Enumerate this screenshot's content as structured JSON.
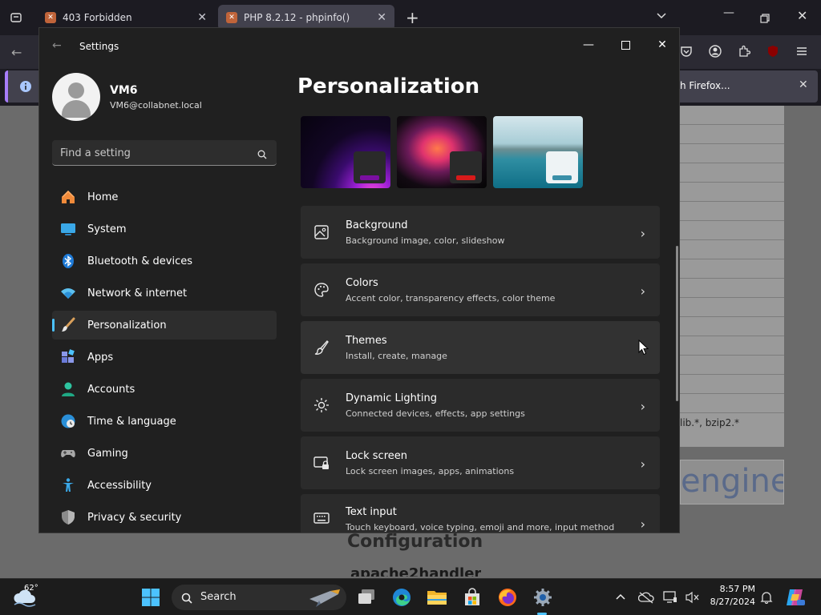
{
  "browser": {
    "tabs": [
      {
        "title": "403 Forbidden"
      },
      {
        "title": "PHP 8.2.12 - phpinfo()"
      }
    ],
    "notification": {
      "text": "h Firefox..."
    },
    "php": {
      "rows_text": "lib.*, bzip2.*",
      "engine_text": "engine",
      "config_heading": "Configuration",
      "apache_heading": "apache2handler"
    }
  },
  "settings": {
    "window_title": "Settings",
    "user": {
      "name": "VM6",
      "email": "VM6@collabnet.local"
    },
    "search_placeholder": "Find a setting",
    "nav": [
      {
        "label": "Home"
      },
      {
        "label": "System"
      },
      {
        "label": "Bluetooth & devices"
      },
      {
        "label": "Network & internet"
      },
      {
        "label": "Personalization"
      },
      {
        "label": "Apps"
      },
      {
        "label": "Accounts"
      },
      {
        "label": "Time & language"
      },
      {
        "label": "Gaming"
      },
      {
        "label": "Accessibility"
      },
      {
        "label": "Privacy & security"
      }
    ],
    "page_title": "Personalization",
    "cards": [
      {
        "title": "Background",
        "subtitle": "Background image, color, slideshow"
      },
      {
        "title": "Colors",
        "subtitle": "Accent color, transparency effects, color theme"
      },
      {
        "title": "Themes",
        "subtitle": "Install, create, manage"
      },
      {
        "title": "Dynamic Lighting",
        "subtitle": "Connected devices, effects, app settings"
      },
      {
        "title": "Lock screen",
        "subtitle": "Lock screen images, apps, animations"
      },
      {
        "title": "Text input",
        "subtitle": "Touch keyboard, voice typing, emoji and more, input method"
      }
    ],
    "theme_accents": [
      "#7a0fa0",
      "#d81a1a",
      "#3a8fa8"
    ]
  },
  "taskbar": {
    "temperature": "62°",
    "search_label": "Search",
    "time": "8:57 PM",
    "date": "8/27/2024",
    "accent": "#4cc2ff"
  }
}
